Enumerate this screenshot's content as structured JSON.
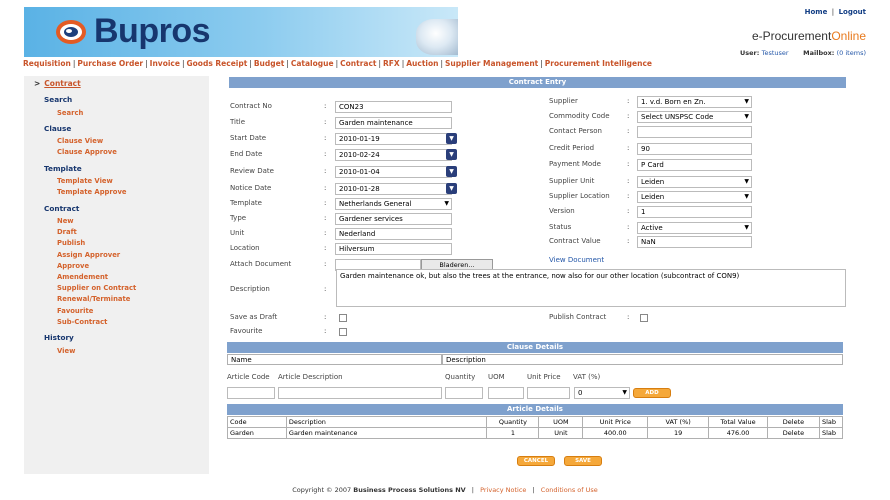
{
  "brand": {
    "name": "Bupros"
  },
  "top_links": {
    "home": "Home",
    "sep": "|",
    "logout": "Logout"
  },
  "product": {
    "title_main": "e-Procurement",
    "title_accent": "Online"
  },
  "user": {
    "label": "User:",
    "value": "Testuser",
    "mailbox_label": "Mailbox:",
    "mailbox_value": "(0 items)"
  },
  "menu": [
    "Requisition",
    "Purchase Order",
    "Invoice",
    "Goods Receipt",
    "Budget",
    "Catalogue",
    "Contract",
    "RFX",
    "Auction",
    "Supplier Management",
    "Procurement Intelligence"
  ],
  "sidebar": {
    "current_arrow": ">",
    "current": "Contract",
    "sections": [
      {
        "title": "Search",
        "items": [
          "Search"
        ]
      },
      {
        "title": "Clause",
        "items": [
          "Clause View",
          "Clause Approve"
        ]
      },
      {
        "title": "Template",
        "items": [
          "Template View",
          "Template Approve"
        ]
      },
      {
        "title": "Contract",
        "items": [
          "New",
          "Draft",
          "Publish",
          "Assign Approver",
          "Approve",
          "Amendement",
          "Supplier on Contract",
          "Renewal/Terminate",
          "Favourite",
          "Sub-Contract"
        ]
      },
      {
        "title": "History",
        "items": [
          "View"
        ]
      }
    ]
  },
  "form": {
    "title": "Contract Entry",
    "colon": ":",
    "calendar_glyph": "▼",
    "select_glyph": "▼",
    "left": [
      {
        "label": "Contract No",
        "value": "CON23"
      },
      {
        "label": "Title",
        "value": "Garden maintenance"
      },
      {
        "label": "Start Date",
        "value": "2010-01-19"
      },
      {
        "label": "End Date",
        "value": "2010-02-24"
      },
      {
        "label": "Review Date",
        "value": "2010-01-04"
      },
      {
        "label": "Notice Date",
        "value": "2010-01-28"
      },
      {
        "label": "Template",
        "value": "Netherlands General"
      },
      {
        "label": "Type",
        "value": "Gardener services"
      },
      {
        "label": "Unit",
        "value": "Nederland"
      },
      {
        "label": "Location",
        "value": "Hilversum"
      },
      {
        "label": "Attach Document",
        "value": ""
      }
    ],
    "right": [
      {
        "label": "Supplier",
        "value": "1. v.d. Born en Zn."
      },
      {
        "label": "Commodity Code",
        "value": "Select UNSPSC Code"
      },
      {
        "label": "Contact Person",
        "value": ""
      },
      {
        "label": "Credit Period",
        "value": "90"
      },
      {
        "label": "Payment Mode",
        "value": "P Card"
      },
      {
        "label": "Supplier Unit",
        "value": "Leiden"
      },
      {
        "label": "Supplier Location",
        "value": "Leiden"
      },
      {
        "label": "Version",
        "value": "1"
      },
      {
        "label": "Status",
        "value": "Active"
      },
      {
        "label": "Contract Value",
        "value": "NaN"
      }
    ],
    "browse_label": "Bladeren...",
    "view_document": "View Document",
    "description_label": "Description",
    "description": "Garden maintenance ok, but also the trees at the entrance, now also for our other location (subcontract of CON9)",
    "save_as_draft": "Save as Draft",
    "publish_contract": "Publish Contract",
    "favourite": "Favourite"
  },
  "clause": {
    "title": "Clause Details",
    "col_name": "Name",
    "col_desc": "Description"
  },
  "article_entry": {
    "headers": [
      "Article Code",
      "Article Description",
      "Quantity",
      "UOM",
      "Unit Price",
      "VAT (%)"
    ],
    "vat_value": "0",
    "add_label": "ADD"
  },
  "articles": {
    "title": "Article Details",
    "headers": [
      "Code",
      "Description",
      "Quantity",
      "UOM",
      "Unit Price",
      "VAT (%)",
      "Total Value",
      "Delete",
      "Slab"
    ],
    "rows": [
      [
        "Garden",
        "Garden maintenance",
        "1",
        "Unit",
        "400.00",
        "19",
        "476.00",
        "Delete",
        "Slab"
      ]
    ]
  },
  "buttons": {
    "cancel": "CANCEL",
    "save": "SAVE"
  },
  "footer": {
    "copyright": "Copyright © 2007",
    "company": "Business Process Solutions NV",
    "sep": "|",
    "privacy": "Privacy Notice",
    "conditions": "Conditions of Use"
  },
  "colors": {
    "accent": "#c8542a",
    "navy": "#17366e",
    "titlebar": "#7fa1cd",
    "button": "#f5a83a"
  }
}
